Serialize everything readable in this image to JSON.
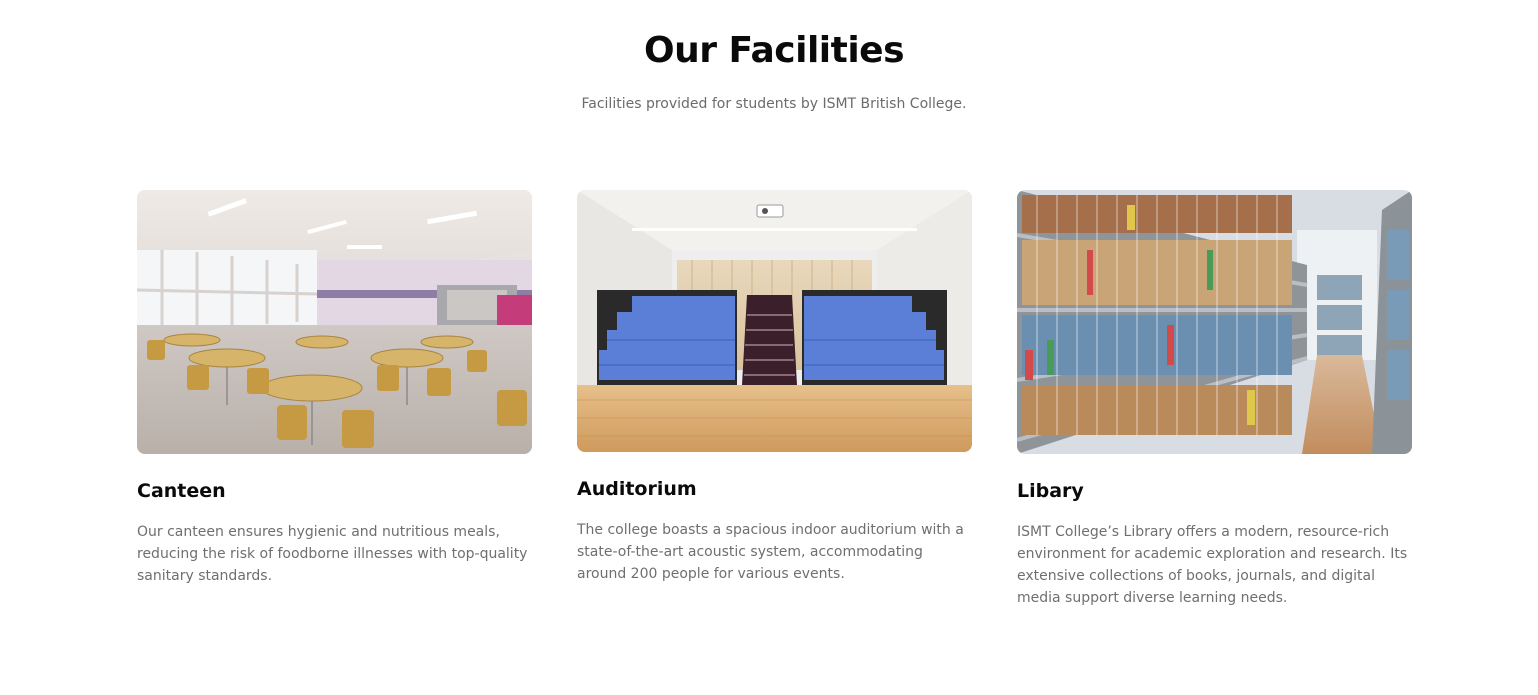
{
  "section": {
    "title": "Our Facilities",
    "subtitle": "Facilities provided for students by ISMT British College."
  },
  "facilities": [
    {
      "name": "Canteen",
      "description": "Our canteen ensures hygienic and nutritious meals, reducing the risk of foodborne illnesses with top-quality sanitary standards.",
      "image": "canteen-photo"
    },
    {
      "name": "Auditorium",
      "description": "The college boasts a spacious indoor auditorium with a state-of-the-art acoustic system, accommodating around 200 people for various events.",
      "image": "auditorium-photo"
    },
    {
      "name": "Libary",
      "description": "ISMT College’s Library offers a modern, resource-rich environment for academic exploration and research. Its extensive collections of books, journals, and digital media support diverse learning needs.",
      "image": "library-photo"
    }
  ]
}
